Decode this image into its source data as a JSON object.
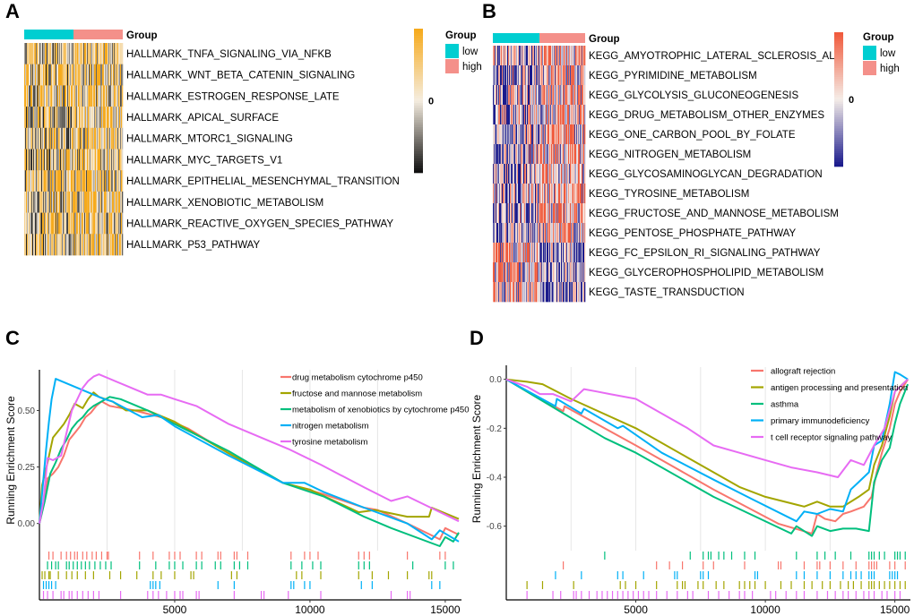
{
  "panels": {
    "A": {
      "letter": "A"
    },
    "B": {
      "letter": "B"
    },
    "C": {
      "letter": "C"
    },
    "D": {
      "letter": "D"
    }
  },
  "chart_data": [
    {
      "id": "A",
      "type": "heatmap",
      "title": "",
      "annotation_label": "Group",
      "groups": [
        {
          "name": "low",
          "color": "#00CED1"
        },
        {
          "name": "high",
          "color": "#F4908A"
        }
      ],
      "group_split_fraction": 0.5,
      "rows": [
        "HALLMARK_TNFA_SIGNALING_VIA_NFKB",
        "HALLMARK_WNT_BETA_CATENIN_SIGNALING",
        "HALLMARK_ESTROGEN_RESPONSE_LATE",
        "HALLMARK_APICAL_SURFACE",
        "HALLMARK_MTORC1_SIGNALING",
        "HALLMARK_MYC_TARGETS_V1",
        "HALLMARK_EPITHELIAL_MESENCHYMAL_TRANSITION",
        "HALLMARK_XENOBIOTIC_METABOLISM",
        "HALLMARK_REACTIVE_OXYGEN_SPECIES_PATHWAY",
        "HALLMARK_P53_PATHWAY"
      ],
      "colorbar": {
        "low_color": "#111111",
        "mid_color": "#F5EDE0",
        "high_color": "#F6AA1C",
        "tick_label": "0"
      },
      "legend": {
        "title": "Group",
        "items": [
          "low",
          "high"
        ],
        "placement": "right"
      }
    },
    {
      "id": "B",
      "type": "heatmap",
      "title": "",
      "annotation_label": "Group",
      "groups": [
        {
          "name": "low",
          "color": "#00CED1"
        },
        {
          "name": "high",
          "color": "#F4908A"
        }
      ],
      "group_split_fraction": 0.5,
      "rows": [
        "KEGG_AMYOTROPHIC_LATERAL_SCLEROSIS_ALS",
        "KEGG_PYRIMIDINE_METABOLISM",
        "KEGG_GLYCOLYSIS_GLUCONEOGENESIS",
        "KEGG_DRUG_METABOLISM_OTHER_ENZYMES",
        "KEGG_ONE_CARBON_POOL_BY_FOLATE",
        "KEGG_NITROGEN_METABOLISM",
        "KEGG_GLYCOSAMINOGLYCAN_DEGRADATION",
        "KEGG_TYROSINE_METABOLISM",
        "KEGG_FRUCTOSE_AND_MANNOSE_METABOLISM",
        "KEGG_PENTOSE_PHOSPHATE_PATHWAY",
        "KEGG_FC_EPSILON_RI_SIGNALING_PATHWAY",
        "KEGG_GLYCEROPHOSPHOLIPID_METABOLISM",
        "KEGG_TASTE_TRANSDUCTION"
      ],
      "colorbar": {
        "low_color": "#1A1A8C",
        "mid_color": "#F5EDE8",
        "high_color": "#F05A3C",
        "tick_label": "0"
      },
      "legend": {
        "title": "Group",
        "items": [
          "low",
          "high"
        ],
        "placement": "right"
      }
    },
    {
      "id": "C",
      "type": "line",
      "title": "",
      "xlabel": "",
      "ylabel": "Running Enrichment Score",
      "xlim": [
        0,
        15600
      ],
      "ylim": [
        -0.12,
        0.68
      ],
      "xticks": [
        5000,
        10000,
        15000
      ],
      "xtick_labels": [
        "5000",
        "10000",
        "15000"
      ],
      "yticks": [
        0.0,
        0.25,
        0.5
      ],
      "ytick_labels": [
        "0.00",
        "0.25",
        "0.50"
      ],
      "grid": "vertical",
      "legend_placement": "top-right",
      "series": [
        {
          "name": "drug metabolism cytochrome p450",
          "color": "#F8766D",
          "x": [
            0,
            150,
            300,
            500,
            700,
            900,
            1100,
            1300,
            1500,
            1700,
            1900,
            2100,
            2300,
            2600,
            3500,
            4500,
            5500,
            7000,
            9000,
            10500,
            12000,
            12500,
            13600,
            14800,
            15000,
            15500
          ],
          "y": [
            0.0,
            0.08,
            0.2,
            0.22,
            0.25,
            0.3,
            0.37,
            0.4,
            0.43,
            0.47,
            0.49,
            0.52,
            0.54,
            0.52,
            0.5,
            0.47,
            0.42,
            0.31,
            0.18,
            0.13,
            0.07,
            0.06,
            0.0,
            -0.07,
            -0.02,
            -0.05
          ],
          "hits": [
            350,
            500,
            800,
            1000,
            1150,
            1300,
            1400,
            1600,
            1750,
            1950,
            2100,
            2300,
            2500,
            2550,
            3700,
            4200,
            4800,
            5000,
            5200,
            5800,
            6000,
            6600,
            6700,
            7200,
            7300,
            7700,
            9300,
            9800,
            10000,
            10300,
            11800,
            12000,
            12200,
            13600,
            14800,
            15000
          ]
        },
        {
          "name": "fructose and mannose metabolism",
          "color": "#A3A500",
          "x": [
            0,
            100,
            300,
            500,
            700,
            900,
            1100,
            1300,
            1600,
            1800,
            2000,
            2200,
            2700,
            3200,
            4000,
            5000,
            7000,
            9000,
            10000,
            11800,
            12400,
            13600,
            14400,
            14500,
            15500
          ],
          "y": [
            0.0,
            0.17,
            0.27,
            0.38,
            0.41,
            0.44,
            0.48,
            0.53,
            0.51,
            0.55,
            0.58,
            0.56,
            0.54,
            0.5,
            0.5,
            0.45,
            0.31,
            0.18,
            0.15,
            0.05,
            0.06,
            0.03,
            0.03,
            0.07,
            0.02
          ],
          "hits": [
            100,
            200,
            350,
            400,
            700,
            1000,
            1200,
            1400,
            1700,
            2000,
            2600,
            3000,
            3600,
            4200,
            4500,
            5000,
            5600,
            5700,
            7100,
            7300,
            9500,
            9700,
            10400,
            11800,
            12300,
            12900,
            13600,
            14400,
            14500
          ]
        },
        {
          "name": "metabolism of xenobiotics by cytochrome p450",
          "color": "#00BF7D",
          "x": [
            0,
            200,
            400,
            600,
            800,
            1000,
            1200,
            1400,
            1600,
            1800,
            2000,
            2300,
            2600,
            3000,
            4000,
            5000,
            7000,
            9000,
            10500,
            12000,
            13000,
            14800,
            15000,
            15300,
            15500
          ],
          "y": [
            0.0,
            0.1,
            0.22,
            0.27,
            0.33,
            0.37,
            0.42,
            0.45,
            0.47,
            0.5,
            0.52,
            0.54,
            0.56,
            0.55,
            0.5,
            0.44,
            0.32,
            0.18,
            0.12,
            0.03,
            -0.02,
            -0.1,
            -0.06,
            -0.08,
            -0.04
          ],
          "hits": [
            300,
            450,
            600,
            700,
            1000,
            1100,
            1250,
            1400,
            1550,
            1700,
            1850,
            2050,
            2250,
            2450,
            2650,
            3700,
            4300,
            4800,
            5000,
            5300,
            5800,
            6000,
            6500,
            6700,
            7200,
            7400,
            7700,
            9300,
            9700,
            10100,
            10400,
            11800,
            12000,
            12200,
            13800,
            15000,
            15300
          ]
        },
        {
          "name": "nitrogen metabolism",
          "color": "#00B0F6",
          "x": [
            0,
            150,
            250,
            350,
            450,
            600,
            2400,
            2700,
            3800,
            4400,
            5000,
            7000,
            9000,
            9800,
            10500,
            12000,
            13600,
            14500,
            14800,
            15500
          ],
          "y": [
            0.0,
            0.2,
            0.33,
            0.45,
            0.55,
            0.64,
            0.55,
            0.54,
            0.47,
            0.48,
            0.43,
            0.3,
            0.18,
            0.18,
            0.14,
            0.07,
            0.0,
            -0.07,
            -0.03,
            -0.08
          ],
          "hits": [
            150,
            250,
            350,
            450,
            600,
            4100,
            4200,
            4300,
            4450,
            6600,
            7200,
            9300,
            9400,
            9800,
            10000,
            11900,
            12300,
            14500,
            14800
          ]
        },
        {
          "name": "tyrosine metabolism",
          "color": "#E76BF3",
          "x": [
            0,
            150,
            300,
            500,
            800,
            1000,
            1200,
            1400,
            1600,
            1800,
            2000,
            2200,
            3200,
            4000,
            4500,
            5000,
            5800,
            7000,
            8200,
            9200,
            10400,
            12000,
            13000,
            13600,
            15500
          ],
          "y": [
            0.0,
            0.1,
            0.29,
            0.28,
            0.3,
            0.4,
            0.5,
            0.55,
            0.6,
            0.63,
            0.65,
            0.66,
            0.61,
            0.57,
            0.57,
            0.55,
            0.52,
            0.44,
            0.38,
            0.33,
            0.26,
            0.16,
            0.1,
            0.12,
            0.01
          ],
          "hits": [
            150,
            300,
            500,
            800,
            900,
            1100,
            1200,
            1400,
            1600,
            1800,
            2000,
            2200,
            3000,
            4000,
            4200,
            4400,
            4700,
            5000,
            5200,
            5300,
            5800,
            5900,
            7200,
            8200,
            8300,
            9200,
            10400,
            13000,
            13600,
            13700
          ]
        }
      ]
    },
    {
      "id": "D",
      "type": "line",
      "title": "",
      "xlabel": "",
      "ylabel": "Running Enrichment Score",
      "xlim": [
        0,
        15600
      ],
      "ylim": [
        -0.7,
        0.05
      ],
      "xticks": [
        5000,
        10000,
        15000
      ],
      "xtick_labels": [
        "5000",
        "10000",
        "15000"
      ],
      "yticks": [
        0.0,
        -0.2,
        -0.4,
        -0.6
      ],
      "ytick_labels": [
        "0.0",
        "-0.2",
        "-0.4",
        "-0.6"
      ],
      "grid": "vertical",
      "legend_placement": "top-right",
      "series": [
        {
          "name": "allograft rejection",
          "color": "#F8766D",
          "x": [
            0,
            2200,
            2250,
            5000,
            8000,
            10500,
            11800,
            12000,
            12300,
            12700,
            13000,
            13300,
            13800,
            14100,
            14300,
            14500,
            14800,
            15000,
            15200,
            15500
          ],
          "y": [
            0.0,
            -0.13,
            -0.11,
            -0.27,
            -0.45,
            -0.59,
            -0.63,
            -0.55,
            -0.57,
            -0.58,
            -0.55,
            -0.54,
            -0.52,
            -0.48,
            -0.38,
            -0.3,
            -0.2,
            -0.1,
            -0.05,
            0.0
          ],
          "hits": [
            2200,
            5800,
            6300,
            6800,
            7600,
            8000,
            9200,
            10500,
            10600,
            11500,
            12000,
            12100,
            12500,
            13000,
            13500,
            14000,
            14100,
            14200,
            14300,
            14800,
            15000,
            15400
          ]
        },
        {
          "name": "antigen processing and presentation",
          "color": "#A3A500",
          "x": [
            0,
            800,
            1400,
            2500,
            5000,
            7000,
            9000,
            10000,
            11500,
            12000,
            12500,
            13000,
            13600,
            14000,
            14200,
            14500,
            14800,
            15000,
            15300,
            15500
          ],
          "y": [
            0.0,
            -0.01,
            -0.02,
            -0.08,
            -0.2,
            -0.32,
            -0.44,
            -0.48,
            -0.52,
            -0.5,
            -0.52,
            -0.52,
            -0.48,
            -0.45,
            -0.35,
            -0.27,
            -0.15,
            -0.05,
            -0.02,
            0.0
          ],
          "hits": [
            800,
            1400,
            2600,
            4400,
            4600,
            5000,
            5800,
            6600,
            6800,
            6900,
            7400,
            7600,
            8100,
            8400,
            9000,
            9200,
            9400,
            9600,
            10000,
            10600,
            11000,
            11500,
            11800,
            12200,
            12500,
            12900,
            13200,
            13400,
            13700,
            14000,
            14100,
            14200,
            14400,
            14600,
            14800,
            15000,
            15200,
            15400
          ]
        },
        {
          "name": "asthma",
          "color": "#00BF7D",
          "x": [
            0,
            3800,
            5000,
            8000,
            11000,
            11200,
            11800,
            12000,
            12500,
            13000,
            13500,
            14000,
            14200,
            14500,
            14800,
            15000,
            15200,
            15500
          ],
          "y": [
            0.0,
            -0.24,
            -0.3,
            -0.48,
            -0.63,
            -0.6,
            -0.64,
            -0.6,
            -0.62,
            -0.61,
            -0.61,
            -0.62,
            -0.42,
            -0.33,
            -0.28,
            -0.18,
            -0.1,
            -0.02
          ],
          "hits": [
            3800,
            7100,
            7600,
            7800,
            7900,
            8200,
            8400,
            8700,
            9200,
            9600,
            11200,
            12000,
            12300,
            12700,
            13300,
            14000,
            14100,
            14200,
            14400,
            14600,
            15000,
            15100,
            15200,
            15400
          ]
        },
        {
          "name": "primary immunodeficiency",
          "color": "#00B0F6",
          "x": [
            0,
            1900,
            1950,
            2900,
            3000,
            4300,
            4500,
            6000,
            8000,
            9500,
            11200,
            11500,
            12000,
            12500,
            13000,
            13300,
            13600,
            14000,
            14200,
            14500,
            14800,
            15000,
            15200,
            15500
          ],
          "y": [
            0.0,
            -0.11,
            -0.08,
            -0.14,
            -0.12,
            -0.2,
            -0.19,
            -0.3,
            -0.41,
            -0.49,
            -0.58,
            -0.54,
            -0.55,
            -0.53,
            -0.54,
            -0.45,
            -0.42,
            -0.38,
            -0.27,
            -0.25,
            -0.1,
            0.03,
            0.02,
            0.0
          ],
          "hits": [
            1900,
            2900,
            4300,
            4500,
            5300,
            6500,
            6600,
            7500,
            7600,
            7800,
            9600,
            9700,
            11200,
            11500,
            12000,
            12500,
            13000,
            13300,
            13500,
            13700,
            14000,
            14100,
            14200,
            14800,
            14900,
            15000,
            15100
          ]
        },
        {
          "name": "t cell receptor signaling pathway",
          "color": "#E76BF3",
          "x": [
            0,
            800,
            1300,
            1800,
            2500,
            3000,
            3500,
            4000,
            5000,
            6000,
            7000,
            8000,
            9000,
            10000,
            11000,
            12000,
            12800,
            13300,
            13800,
            14200,
            14600,
            15000,
            15500
          ],
          "y": [
            0.0,
            -0.03,
            -0.06,
            -0.06,
            -0.09,
            -0.04,
            -0.05,
            -0.06,
            -0.08,
            -0.14,
            -0.2,
            -0.27,
            -0.3,
            -0.33,
            -0.36,
            -0.38,
            -0.4,
            -0.33,
            -0.35,
            -0.27,
            -0.2,
            -0.05,
            0.0
          ],
          "hits": [
            800,
            1800,
            2100,
            2600,
            2700,
            2900,
            3200,
            3500,
            3700,
            3900,
            4100,
            4300,
            4500,
            4700,
            4900,
            5100,
            5300,
            5500,
            5800,
            6200,
            6600,
            7000,
            7200,
            7800,
            8200,
            8600,
            9000,
            9200,
            9500,
            10200,
            10400,
            10800,
            11200,
            11500,
            12000,
            12400,
            12700,
            13000,
            13200,
            13500,
            13800,
            14000,
            14200,
            14500,
            14700,
            15000,
            15200
          ]
        }
      ]
    }
  ]
}
